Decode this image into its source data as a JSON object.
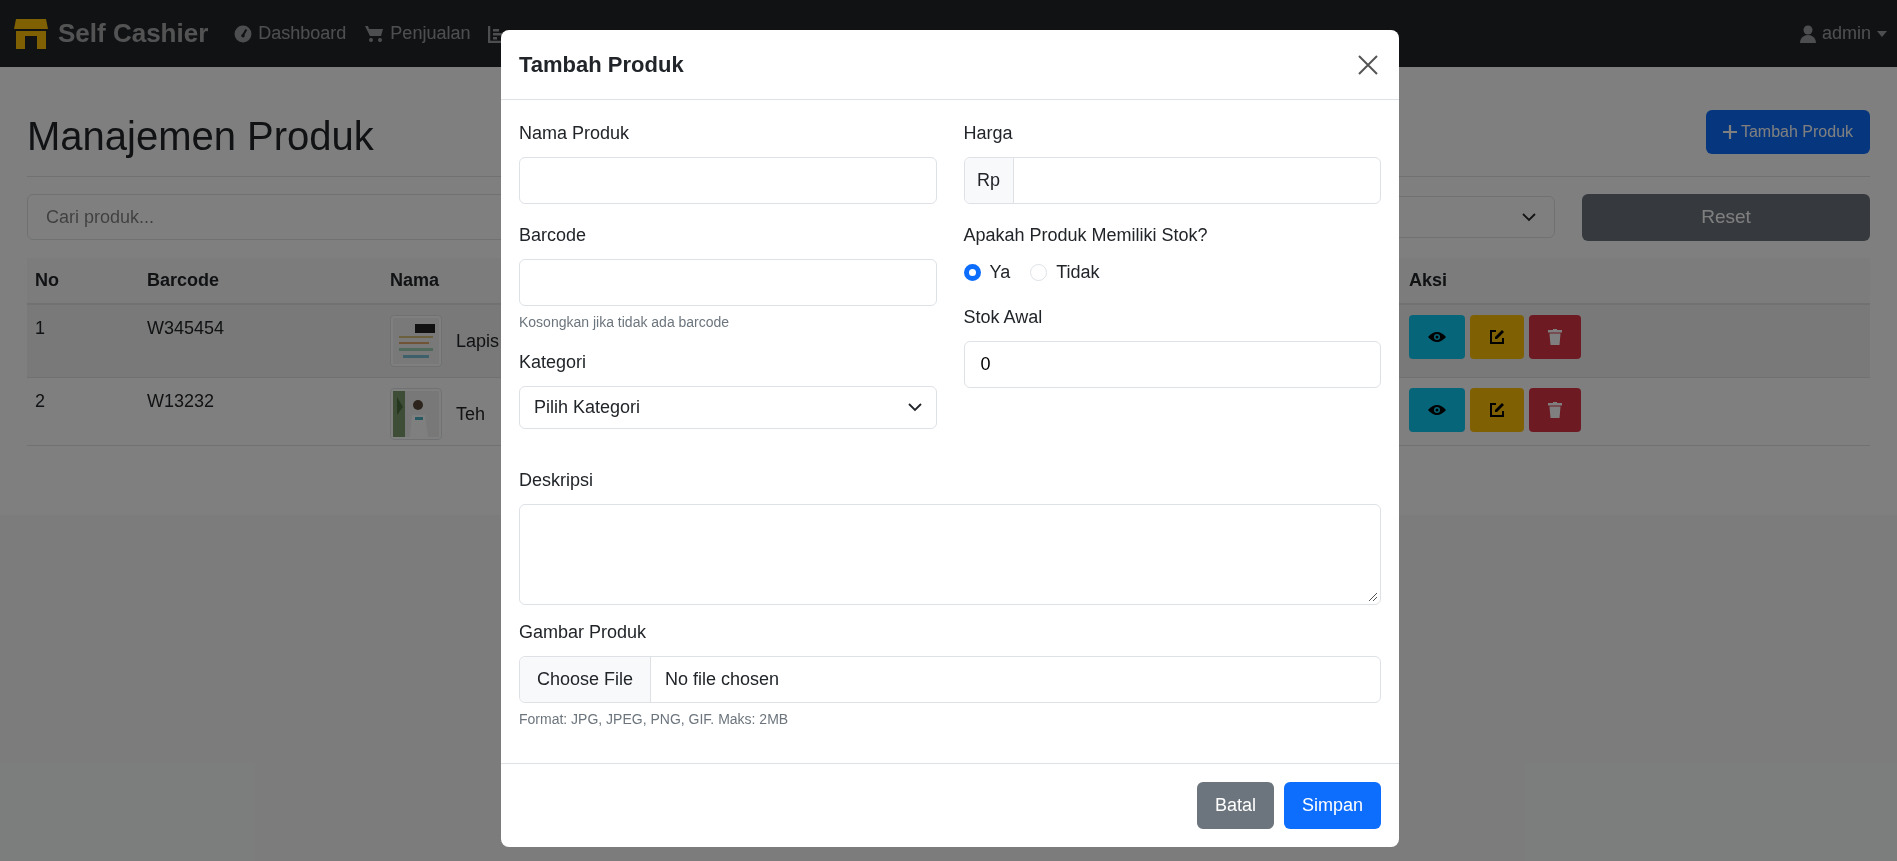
{
  "navbar": {
    "brand": "Self Cashier",
    "items": [
      {
        "label": "Dashboard",
        "selected": false
      },
      {
        "label": "Penjualan",
        "selected": false
      }
    ],
    "user": "admin"
  },
  "page": {
    "title": "Manajemen Produk",
    "add_button": "Tambah Produk",
    "search": {
      "placeholder": "Cari produk..."
    },
    "reset_button": "Reset"
  },
  "table": {
    "columns": [
      "No",
      "Barcode",
      "Nama",
      "Aksi"
    ],
    "rows": [
      {
        "no": "1",
        "barcode": "W345454",
        "name": "Lapis"
      },
      {
        "no": "2",
        "barcode": "W13232",
        "name": "Teh"
      }
    ]
  },
  "modal": {
    "title": "Tambah Produk",
    "nama_produk": {
      "label": "Nama Produk"
    },
    "harga": {
      "label": "Harga",
      "prefix": "Rp"
    },
    "barcode": {
      "label": "Barcode",
      "help": "Kosongkan jika tidak ada barcode"
    },
    "stok_question": {
      "label": "Apakah Produk Memiliki Stok?",
      "options": [
        {
          "label": "Ya",
          "selected": true
        },
        {
          "label": "Tidak",
          "selected": false
        }
      ]
    },
    "stok_awal": {
      "label": "Stok Awal",
      "value": "0"
    },
    "kategori": {
      "label": "Kategori",
      "value": "Pilih Kategori"
    },
    "deskripsi": {
      "label": "Deskripsi"
    },
    "gambar": {
      "label": "Gambar Produk",
      "button": "Choose File",
      "status": "No file chosen",
      "help": "Format: JPG, JPEG, PNG, GIF. Maks: 2MB"
    },
    "buttons": [
      {
        "label": "Batal",
        "kind": "secondary"
      },
      {
        "label": "Simpan",
        "kind": "primary"
      }
    ]
  }
}
